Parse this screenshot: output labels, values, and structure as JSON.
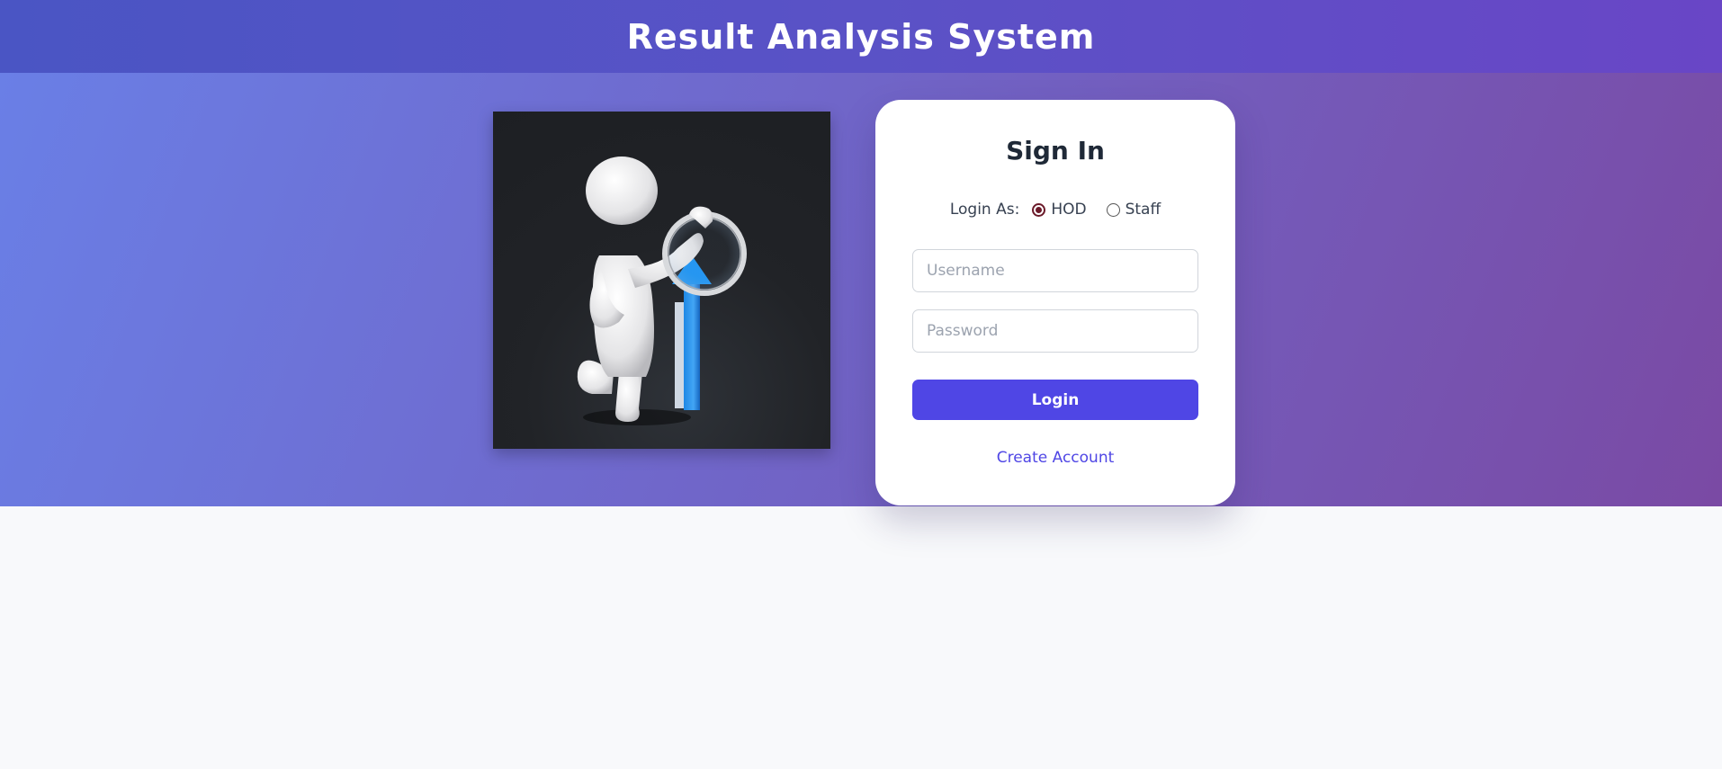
{
  "header": {
    "title": "Result Analysis System"
  },
  "illustration": {
    "icon": "person-with-magnifier-and-growth-arrow"
  },
  "signin": {
    "title": "Sign In",
    "login_as_label": "Login As:",
    "roles": [
      {
        "label": "HOD",
        "selected": true
      },
      {
        "label": "Staff",
        "selected": false
      }
    ],
    "username_placeholder": "Username",
    "password_placeholder": "Password",
    "login_label": "Login",
    "create_account_label": "Create Account"
  },
  "colors": {
    "header_gradient_start": "#4a55c4",
    "header_gradient_end": "#6946c6",
    "accent": "#4f46e5",
    "radio_selected": "#6b1a2a",
    "page_background": "#f8f9fb"
  }
}
